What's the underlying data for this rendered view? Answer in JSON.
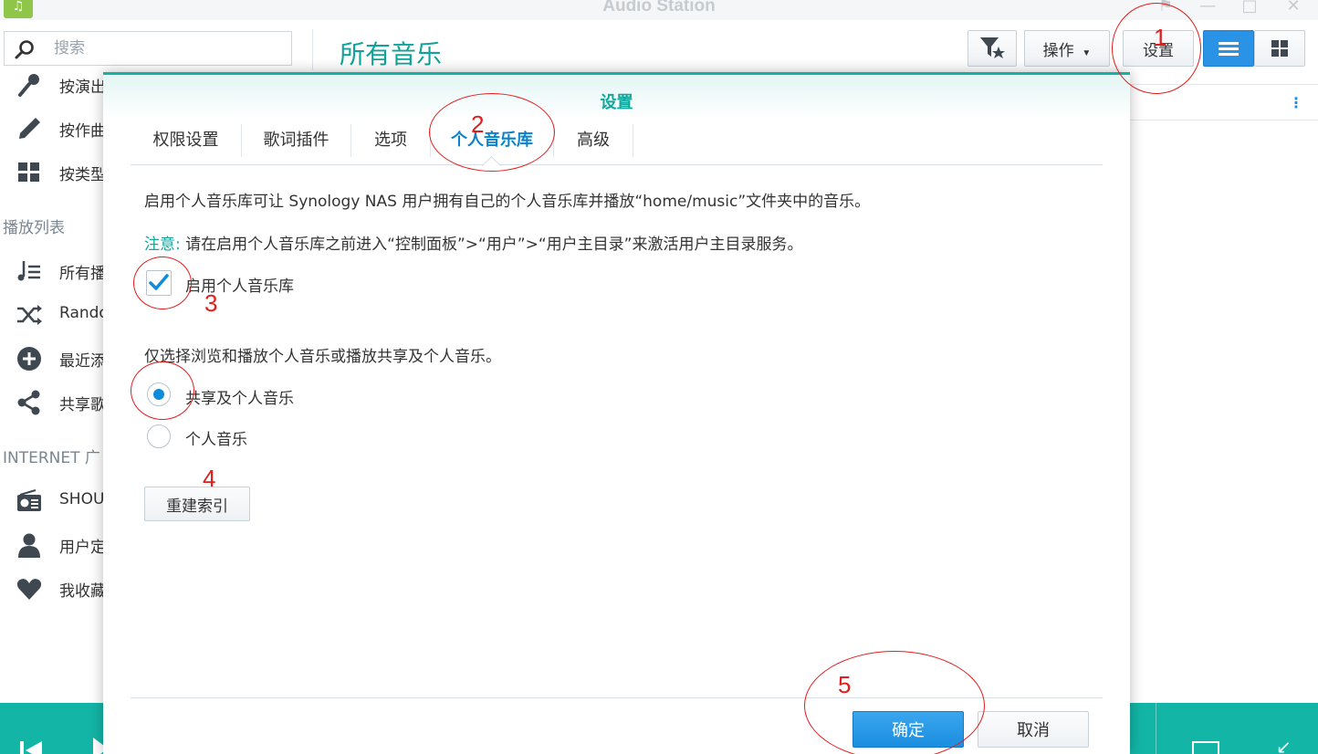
{
  "window": {
    "title": "Audio Station",
    "app_icon": "music-note-icon"
  },
  "search": {
    "placeholder": "搜索"
  },
  "sidebar": {
    "items_top": [
      {
        "label": "按演出",
        "icon": "microphone-icon"
      },
      {
        "label": "按作曲",
        "icon": "pencil-icon"
      },
      {
        "label": "按类型",
        "icon": "grid-icon"
      }
    ],
    "section_playlist": "播放列表",
    "playlist_items": [
      {
        "label": "所有播",
        "icon": "playlist-icon"
      },
      {
        "label": "Rando",
        "icon": "shuffle-icon"
      },
      {
        "label": "最近添",
        "icon": "plus-circle-icon"
      },
      {
        "label": "共享歌",
        "icon": "share-icon"
      }
    ],
    "section_internet": "INTERNET 广",
    "internet_items": [
      {
        "label": "SHOU",
        "icon": "radio-icon"
      },
      {
        "label": "用户定",
        "icon": "user-icon"
      },
      {
        "label": "我收藏",
        "icon": "heart-icon"
      }
    ]
  },
  "main": {
    "title": "所有音乐",
    "toolbar": {
      "filter_icon": "filter-star-icon",
      "action_label": "操作",
      "settings_label": "设置",
      "list_view_icon": "list-view-icon",
      "grid_view_icon": "grid-view-icon"
    }
  },
  "dialog": {
    "title": "设置",
    "tabs": [
      "权限设置",
      "歌词插件",
      "选项",
      "个人音乐库",
      "高级"
    ],
    "active_tab": "个人音乐库",
    "description": "启用个人音乐库可让 Synology NAS 用户拥有自己的个人音乐库并播放“home/music”文件夹中的音乐。",
    "note_label": "注意:",
    "note_text": "请在启用个人音乐库之前进入“控制面板”>“用户”>“用户主目录”来激活用户主目录服务。",
    "enable_checkbox": {
      "label": "启用个人音乐库",
      "checked": true
    },
    "radio_caption": "仅选择浏览和播放个人音乐或播放共享及个人音乐。",
    "radio_options": [
      {
        "label": "共享及个人音乐",
        "selected": true
      },
      {
        "label": "个人音乐",
        "selected": false
      }
    ],
    "rebuild_button": "重建索引",
    "ok_button": "确定",
    "cancel_button": "取消"
  },
  "annotations": [
    "1",
    "2",
    "3",
    "4",
    "5"
  ],
  "colors": {
    "accent_teal": "#14b1a6",
    "primary_blue": "#1a8ee0",
    "annotation_red": "#e21d1d"
  }
}
